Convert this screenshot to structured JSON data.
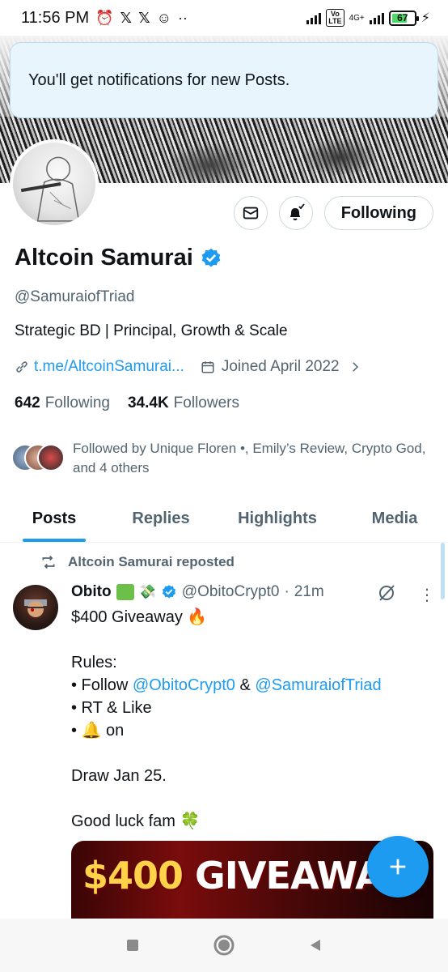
{
  "status_bar": {
    "time": "11:56 PM",
    "network": "4G+",
    "battery": "67"
  },
  "toast": {
    "message": "You'll get notifications for new Posts."
  },
  "profile": {
    "name": "Altcoin Samurai",
    "handle": "@SamuraiofTriad",
    "bio": "Strategic BD | Principal, Growth & Scale",
    "link": "t.me/AltcoinSamurai...",
    "joined": "Joined April 2022",
    "following_count": "642",
    "following_label": "Following",
    "followers_count": "34.4K",
    "followers_label": "Followers",
    "followed_by": "Followed by Unique Floren •, Emily’s Review, Crypto God, and 4 others",
    "follow_button": "Following",
    "verified_color": "#1d9bf0"
  },
  "tabs": [
    {
      "label": "Posts",
      "active": true
    },
    {
      "label": "Replies",
      "active": false
    },
    {
      "label": "Highlights",
      "active": false
    },
    {
      "label": "Media",
      "active": false
    }
  ],
  "tweet": {
    "repost_label": "Altcoin Samurai reposted",
    "author_name": "Obito",
    "author_handle": "@ObitoCrypt0",
    "time": "21m",
    "lines": {
      "title": "$400 Giveaway 🔥",
      "rules": "Rules:",
      "follow_prefix": "• Follow ",
      "mention1": "@ObitoCrypt0",
      "amp": " & ",
      "mention2": "@SamuraiofTriad",
      "rt": "• RT & Like",
      "bell": "• 🔔 on",
      "draw": "Draw Jan 25.",
      "luck": "Good luck fam 🍀"
    },
    "image_text_amount": "$400",
    "image_text_word": "GIVEAWAY"
  },
  "colors": {
    "accent": "#1d9bf0",
    "text_primary": "#0f1419",
    "text_secondary": "#536471"
  },
  "icons": [
    "alarm-icon",
    "x-logo-icon",
    "mail-icon",
    "bell-check-icon",
    "link-icon",
    "calendar-icon",
    "chevron-right-icon",
    "repost-icon",
    "grok-icon",
    "more-icon",
    "plus-icon"
  ]
}
